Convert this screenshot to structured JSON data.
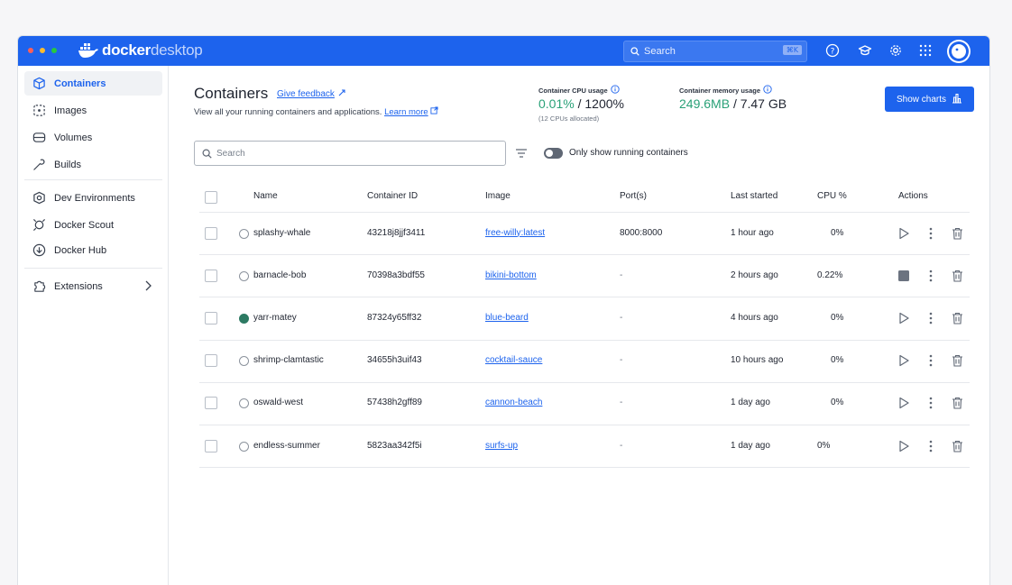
{
  "app": {
    "brand_bold": "docker",
    "brand_light": "desktop",
    "colors": {
      "titlebar": "#1d63ed",
      "accent": "#1d63ed",
      "green": "#2aa178",
      "running": "#2d7a63"
    },
    "traffic_lights": [
      "#ff5f57",
      "#febc2e",
      "#28c840"
    ]
  },
  "topbar": {
    "search_placeholder": "Search",
    "shortcut": "⌘K",
    "icons": [
      "help-icon",
      "learning-center-icon",
      "settings-icon",
      "extensions-grid-icon",
      "account-avatar-icon"
    ]
  },
  "sidebar": {
    "items": [
      {
        "label": "Containers",
        "icon": "containers-icon",
        "active": true
      },
      {
        "label": "Images",
        "icon": "images-icon"
      },
      {
        "label": "Volumes",
        "icon": "volumes-icon"
      },
      {
        "label": "Builds",
        "icon": "builds-icon"
      },
      {
        "label": "Dev Environments",
        "icon": "dev-environments-icon"
      },
      {
        "label": "Docker Scout",
        "icon": "docker-scout-icon"
      },
      {
        "label": "Docker Hub",
        "icon": "docker-hub-icon"
      },
      {
        "label": "Extensions",
        "icon": "extensions-icon"
      }
    ]
  },
  "page": {
    "title": "Containers",
    "feedback": "Give feedback",
    "subtitle": "View all your running containers and applications.",
    "learn_more": "Learn more",
    "cpu_label": "Container CPU usage",
    "cpu_value": "0.01%",
    "cpu_total": "/ 1200%",
    "cpu_note": "(12 CPUs allocated)",
    "mem_label": "Container memory usage",
    "mem_value": "249.6MB",
    "mem_total": "/ 7.47 GB",
    "show_charts": "Show charts",
    "search_placeholder": "Search",
    "toggle_label": "Only show running containers",
    "toggle_on": false
  },
  "table": {
    "headers": [
      "Name",
      "Container ID",
      "Image",
      "Port(s)",
      "Last started",
      "CPU %",
      "Actions"
    ],
    "rows": [
      {
        "name": "splashy-whale",
        "id": "43218j8jjf3411",
        "image": "free-willy:latest",
        "ports": "8000:8000",
        "started": "1 hour ago",
        "cpu": "0%",
        "running": false
      },
      {
        "name": "barnacle-bob",
        "id": "70398a3bdf55",
        "image": "bikini-bottom",
        "ports": "-",
        "started": "2 hours ago",
        "cpu": "0.22%",
        "running": false,
        "action": "stop"
      },
      {
        "name": "yarr-matey",
        "id": "87324y65ff32",
        "image": "blue-beard",
        "ports": "-",
        "started": "4 hours ago",
        "cpu": "0%",
        "running": true
      },
      {
        "name": "shrimp-clamtastic",
        "id": "34655h3uif43",
        "image": "cocktail-sauce",
        "ports": "-",
        "started": "10 hours ago",
        "cpu": "0%",
        "running": false
      },
      {
        "name": "oswald-west",
        "id": "57438h2gff89",
        "image": "cannon-beach",
        "ports": "-",
        "started": "1 day ago",
        "cpu": "0%",
        "running": false
      },
      {
        "name": "endless-summer",
        "id": "5823aa342f5i",
        "image": "surfs-up",
        "ports": "-",
        "started": "1 day ago",
        "cpu": "0%",
        "running": false
      }
    ]
  }
}
